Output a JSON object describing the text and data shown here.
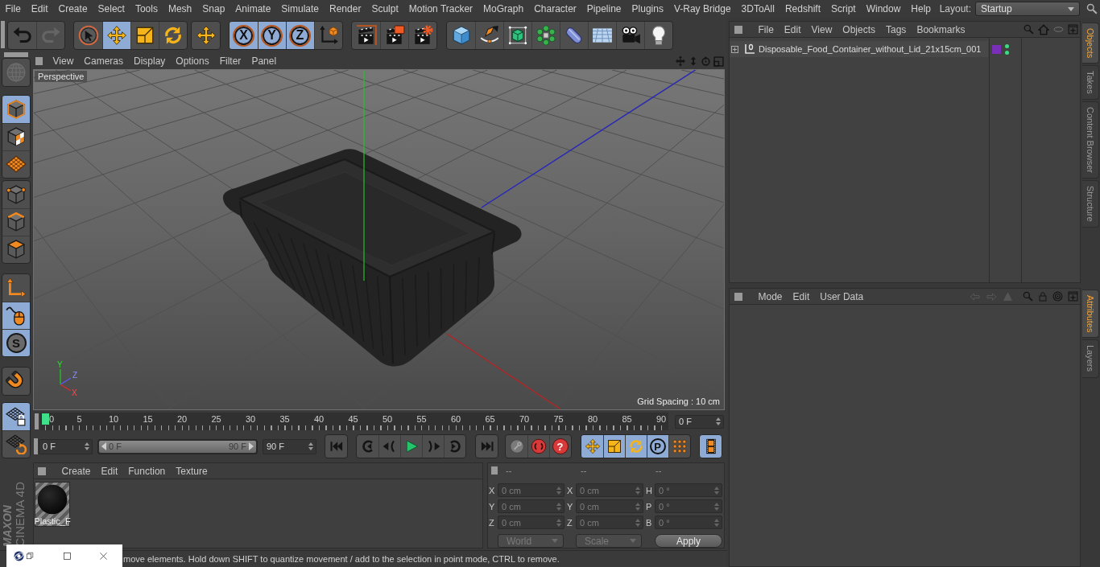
{
  "menu_bar": {
    "items": [
      "File",
      "Edit",
      "Create",
      "Select",
      "Tools",
      "Mesh",
      "Snap",
      "Animate",
      "Simulate",
      "Render",
      "Sculpt",
      "Motion Tracker",
      "MoGraph",
      "Character",
      "Pipeline",
      "Plugins",
      "V-Ray Bridge",
      "3DToAll",
      "Redshift",
      "Script",
      "Window",
      "Help"
    ],
    "layout_label": "Layout:",
    "layout_value": "Startup"
  },
  "toolbar": {
    "groups": [
      [
        {
          "selected": false,
          "disabled": false
        },
        {
          "selected": false,
          "disabled": true
        }
      ],
      [
        {
          "selected": false
        },
        {
          "selected": true
        },
        {
          "selected": false
        },
        {
          "selected": false
        }
      ],
      [
        {
          "selected": false
        }
      ],
      [
        {
          "label": "X",
          "selected": true
        },
        {
          "label": "Y",
          "selected": true
        },
        {
          "label": "Z",
          "selected": true
        },
        {
          "selected": false
        }
      ],
      [
        {
          "selected": false
        },
        {
          "selected": false
        },
        {
          "selected": false
        }
      ],
      [
        {
          "selected": false
        },
        {
          "selected": false
        },
        {
          "selected": false
        },
        {
          "selected": false
        },
        {
          "selected": false
        },
        {
          "selected": false
        },
        {
          "selected": false
        },
        {
          "selected": false
        }
      ]
    ]
  },
  "left_toolbar": {
    "groups": [
      [
        {
          "selected": false,
          "disabled": true
        }
      ],
      [
        {
          "selected": true
        },
        {
          "selected": false
        },
        {
          "selected": false
        }
      ],
      [
        {
          "selected": false
        },
        {
          "selected": false
        },
        {
          "selected": false
        }
      ],
      [
        {
          "selected": false
        },
        {
          "selected": true
        },
        {
          "label": "S",
          "selected": true
        }
      ],
      [
        {
          "selected": false
        }
      ],
      [
        {
          "selected": true
        },
        {
          "selected": false
        }
      ]
    ],
    "logo_brand": "MAXON",
    "logo_product": "CINEMA 4D"
  },
  "viewport": {
    "menu": [
      "View",
      "Cameras",
      "Display",
      "Options",
      "Filter",
      "Panel"
    ],
    "camera": "Perspective",
    "axis_labels": [
      "Y",
      "Z",
      "X"
    ],
    "grid_spacing": "Grid Spacing : 10 cm"
  },
  "timeline": {
    "ruler_labels": [
      "0",
      "5",
      "10",
      "15",
      "20",
      "25",
      "30",
      "35",
      "40",
      "45",
      "50",
      "55",
      "60",
      "65",
      "70",
      "75",
      "80",
      "85",
      "90"
    ],
    "level": 0,
    "current_frame": "0 F",
    "start_frame": "0 F",
    "range": {
      "start": "0 F",
      "end": "90 F",
      "level": 1
    },
    "end_frame": "90 F",
    "controls": [
      [
        {
          "selected": false
        }
      ],
      [
        {
          "selected": false
        },
        {
          "selected": false
        },
        {
          "selected": false
        },
        {
          "selected": false
        },
        {
          "selected": false
        }
      ],
      [
        {
          "selected": false
        }
      ],
      [
        {
          "selected": false
        },
        {
          "selected": false
        },
        {
          "label": "?",
          "selected": false
        }
      ],
      [
        {
          "selected": true
        },
        {
          "selected": true
        },
        {
          "selected": true
        },
        {
          "label": "P",
          "selected": true
        },
        {
          "selected": false
        }
      ],
      [
        {
          "selected": true
        }
      ]
    ]
  },
  "materials": {
    "menu": [
      "Create",
      "Edit",
      "Function",
      "Texture"
    ],
    "items": [
      {
        "name": "Plastic_F"
      }
    ]
  },
  "coordinates": {
    "headers": [
      "--",
      "--",
      "--"
    ],
    "rows": [
      [
        {
          "label": "X",
          "value": "0 cm",
          "disabled": true
        },
        {
          "label": "X",
          "value": "0 cm",
          "disabled": true
        },
        {
          "label": "H",
          "value": "0 °",
          "disabled": true
        }
      ],
      [
        {
          "label": "Y",
          "value": "0 cm",
          "disabled": true
        },
        {
          "label": "Y",
          "value": "0 cm",
          "disabled": true
        },
        {
          "label": "P",
          "value": "0 °",
          "disabled": true
        }
      ],
      [
        {
          "label": "Z",
          "value": "0 cm",
          "disabled": true
        },
        {
          "label": "Z",
          "value": "0 cm",
          "disabled": true
        },
        {
          "label": "B",
          "value": "0 °",
          "disabled": true
        }
      ]
    ],
    "dropdowns": [
      {
        "value": "World",
        "disabled": true
      },
      {
        "value": "Scale",
        "disabled": true
      }
    ],
    "apply": "Apply"
  },
  "status_bar": {
    "text": "move elements. Hold down SHIFT to quantize movement / add to the selection in point mode, CTRL to remove."
  },
  "object_manager": {
    "menu": [
      "File",
      "Edit",
      "View",
      "Objects",
      "Tags",
      "Bookmarks"
    ],
    "objects": [
      {
        "name": "Disposable_Food_Container_without_Lid_21x15cm_001",
        "expanded": false,
        "color": "#7a2fb8",
        "visible_in_editor": true,
        "visible_in_render": true
      }
    ]
  },
  "attributes": {
    "menu": [
      "Mode",
      "Edit",
      "User Data"
    ]
  },
  "side_tabs": {
    "top": [
      {
        "label": "Objects",
        "selected": true
      },
      {
        "label": "Takes",
        "selected": false
      },
      {
        "label": "Content Browser",
        "selected": false
      },
      {
        "label": "Structure",
        "selected": false
      }
    ],
    "bottom": [
      {
        "label": "Attributes",
        "selected": true
      },
      {
        "label": "Layers",
        "selected": false
      }
    ]
  }
}
